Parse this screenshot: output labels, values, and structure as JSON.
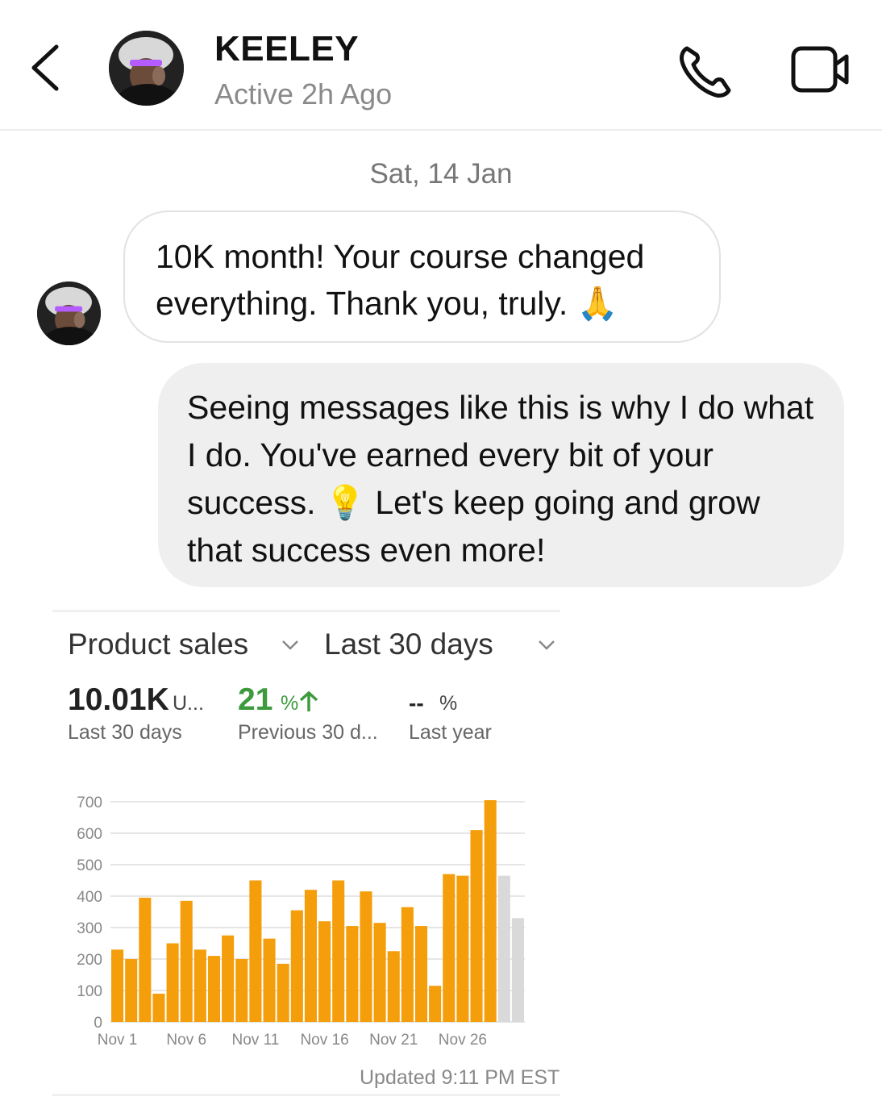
{
  "header": {
    "contact_name": "KEELEY",
    "status": "Active 2h Ago",
    "icons": {
      "back": "chevron-left-icon",
      "call": "phone-icon",
      "video": "video-call-icon"
    }
  },
  "conversation": {
    "date_separator": "Sat, 14 Jan",
    "messages": [
      {
        "from": "contact",
        "text": "10K month! Your course changed everything. Thank you, truly. 🙏"
      },
      {
        "from": "me",
        "text": "Seeing messages like this is why I do what I do. You've earned every bit of your success. 💡 Let's keep going and grow that success even more!"
      }
    ]
  },
  "sales_card": {
    "metric_selector": "Product sales",
    "period_selector": "Last 30 days",
    "metrics": [
      {
        "value": "10.01K",
        "unit": "U...",
        "label": "Last 30 days"
      },
      {
        "value": "21",
        "unit": "%",
        "label": "Previous 30 d...",
        "trend": "up",
        "color": "#3d9a3d"
      },
      {
        "value": "--",
        "unit": "%",
        "label": "Last year"
      }
    ],
    "updated": "Updated 9:11 PM EST"
  },
  "chart_data": {
    "type": "bar",
    "ylim": [
      0,
      700
    ],
    "yticks": [
      0,
      100,
      200,
      300,
      400,
      500,
      600,
      700
    ],
    "xtick_labels": [
      "Nov 1",
      "Nov 6",
      "Nov 11",
      "Nov 16",
      "Nov 21",
      "Nov 26"
    ],
    "xtick_index": [
      0,
      5,
      10,
      15,
      20,
      25
    ],
    "values": [
      230,
      200,
      395,
      90,
      250,
      385,
      230,
      210,
      275,
      200,
      450,
      265,
      185,
      355,
      420,
      320,
      450,
      305,
      415,
      315,
      225,
      365,
      305,
      115,
      470,
      465,
      610,
      705,
      465,
      330
    ],
    "partial_from_index": 28,
    "colors": {
      "bar": "#f59e0b",
      "partial": "#d9d9d9",
      "grid": "#dddddd"
    },
    "grid": true
  }
}
